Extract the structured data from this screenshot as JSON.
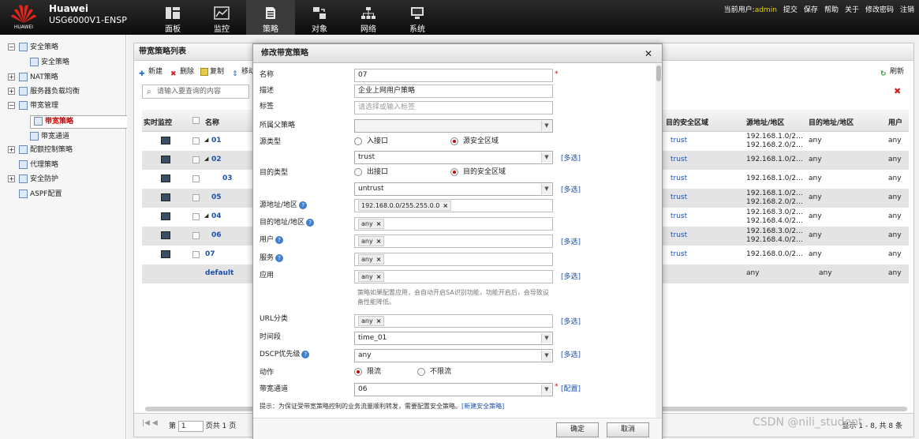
{
  "header": {
    "brand_name": "Huawei",
    "model": "USG6000V1-ENSP",
    "logo_text": "HUAWEI",
    "nav": [
      {
        "label": "面板",
        "icon": "dashboard-icon"
      },
      {
        "label": "监控",
        "icon": "monitor-icon"
      },
      {
        "label": "策略",
        "icon": "policy-icon"
      },
      {
        "label": "对象",
        "icon": "object-icon"
      },
      {
        "label": "网络",
        "icon": "network-icon"
      },
      {
        "label": "系统",
        "icon": "system-icon"
      }
    ],
    "current_user_label": "当前用户:",
    "current_user": "admin",
    "actions": [
      "提交",
      "保存",
      "帮助",
      "关于",
      "修改密码",
      "注销"
    ]
  },
  "sidebar": {
    "items": [
      {
        "label": "安全策略",
        "toggle": "−",
        "level": 0
      },
      {
        "label": "安全策略",
        "toggle": "",
        "level": 1
      },
      {
        "label": "NAT策略",
        "toggle": "+",
        "level": 0
      },
      {
        "label": "服务器负载均衡",
        "toggle": "+",
        "level": 0
      },
      {
        "label": "带宽管理",
        "toggle": "−",
        "level": 0
      },
      {
        "label": "带宽策略",
        "toggle": "",
        "level": 1,
        "selected": true
      },
      {
        "label": "带宽通道",
        "toggle": "",
        "level": 1
      },
      {
        "label": "配额控制策略",
        "toggle": "+",
        "level": 0
      },
      {
        "label": "代理策略",
        "toggle": "",
        "level": 0
      },
      {
        "label": "安全防护",
        "toggle": "+",
        "level": 0
      },
      {
        "label": "ASPF配置",
        "toggle": "",
        "level": 0
      }
    ]
  },
  "list": {
    "title": "带宽策略列表",
    "toolbar": {
      "new": "新建",
      "delete": "删除",
      "copy": "复制",
      "move": "移动"
    },
    "refresh": "刷新",
    "search_placeholder": "请输入要查询的内容",
    "columns": {
      "monitor": "实时监控",
      "name": "名称",
      "zone": "目的安全区域",
      "src": "源地址/地区",
      "dst": "目的地址/地区",
      "user": "用户"
    },
    "rows": [
      {
        "name": "01",
        "arrow": "◢",
        "zone": "trust",
        "src": [
          "192.168.1.0/2...",
          "192.168.2.0/2..."
        ],
        "dst": "any",
        "user": "any"
      },
      {
        "name": "02",
        "arrow": "◢",
        "zone": "trust",
        "src": [
          "192.168.1.0/2..."
        ],
        "dst": "any",
        "user": "any"
      },
      {
        "name": "03",
        "arrow": "",
        "zone": "trust",
        "src": [
          "192.168.1.0/2..."
        ],
        "dst": "any",
        "user": "any"
      },
      {
        "name": "05",
        "arrow": "",
        "zone": "trust",
        "src": [
          "192.168.1.0/2...",
          "192.168.2.0/2..."
        ],
        "dst": "any",
        "user": "any"
      },
      {
        "name": "04",
        "arrow": "◢",
        "zone": "trust",
        "src": [
          "192.168.3.0/2...",
          "192.168.4.0/2..."
        ],
        "dst": "any",
        "user": "any"
      },
      {
        "name": "06",
        "arrow": "",
        "zone": "trust",
        "src": [
          "192.168.3.0/2...",
          "192.168.4.0/2..."
        ],
        "dst": "any",
        "user": "any"
      },
      {
        "name": "07",
        "arrow": "",
        "zone": "trust",
        "src": [
          "192.168.0.0/2..."
        ],
        "dst": "any",
        "user": "any"
      },
      {
        "name": "default",
        "arrow": "",
        "zone": "",
        "src": [
          "any"
        ],
        "dst": "any",
        "user": "any"
      }
    ],
    "pager": {
      "page_label": "第",
      "page": "1",
      "total": "页共 1 页",
      "info": "显示 1 - 8, 共 8 条"
    }
  },
  "dialog": {
    "title": "修改带宽策略",
    "labels": {
      "name": "名称",
      "desc": "描述",
      "tag": "标签",
      "parent": "所属父策略",
      "src_type": "源类型",
      "dst_type": "目的类型",
      "src_addr": "源地址/地区",
      "dst_addr": "目的地址/地区",
      "user": "用户",
      "service": "服务",
      "app": "应用",
      "url": "URL分类",
      "time": "时间段",
      "dscp": "DSCP优先级",
      "action": "动作",
      "channel": "带宽通道"
    },
    "values": {
      "name": "07",
      "desc": "企业上网用户策略",
      "tag_placeholder": "请选择或输入标签",
      "parent": "",
      "src_zone": "trust",
      "dst_zone": "untrust",
      "src_addr": "192.168.0.0/255.255.0.0",
      "dst_addr": "any",
      "user": "any",
      "service": "any",
      "app": "any",
      "url": "any",
      "time": "time_01",
      "dscp": "any",
      "channel": "06"
    },
    "radios": {
      "in_if": "入接口",
      "src_zone": "源安全区域",
      "out_if": "出接口",
      "dst_zone": "目的安全区域",
      "limit": "限流",
      "nolimit": "不限流"
    },
    "multi_link": "[多选]",
    "config_link": "[配置]",
    "app_note": "策略如果配置应用，会自动开启SA识别功能，功能开启后，会导致设备性能降低。",
    "hint": "提示：为保证受带宽策略控制的业务流量顺利转发，需要配置安全策略。",
    "hint_link": "[新建安全策略]",
    "ok": "确定",
    "cancel": "取消"
  },
  "watermark": "CSDN @nili_student"
}
